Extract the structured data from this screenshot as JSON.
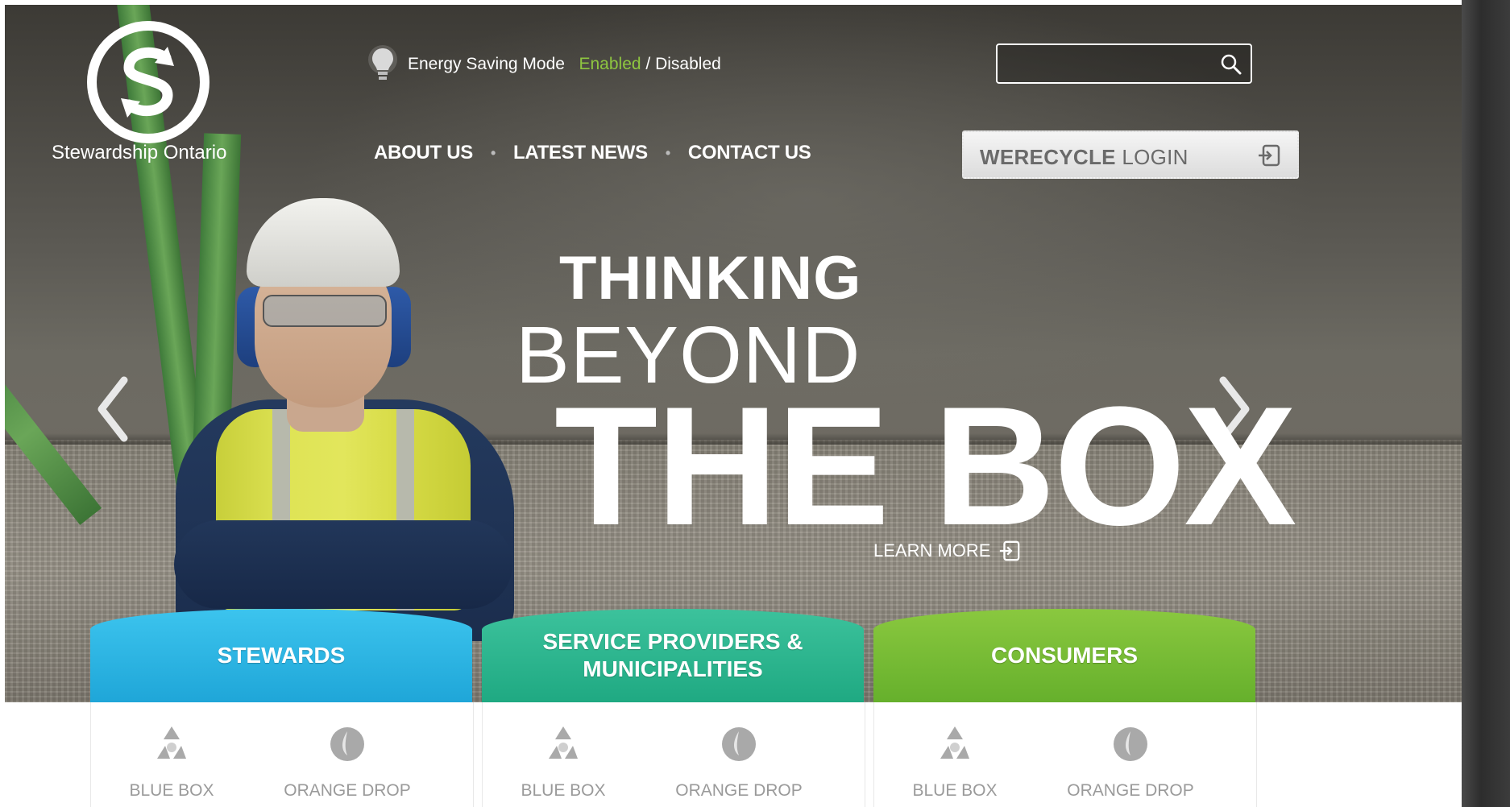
{
  "brand": {
    "name": "Stewardship Ontario"
  },
  "energy": {
    "label": "Energy Saving Mode",
    "enabled": "Enabled",
    "separator": "/",
    "disabled": "Disabled"
  },
  "search": {
    "value": "",
    "placeholder": ""
  },
  "nav": {
    "items": [
      "ABOUT US",
      "LATEST NEWS",
      "CONTACT US"
    ],
    "separator": "•"
  },
  "login": {
    "bold": "WERECYCLE",
    "rest": " LOGIN"
  },
  "hero": {
    "line1": "THINKING",
    "line2": "BEYOND",
    "line3": "THE BOX",
    "learn_more": "LEARN MORE"
  },
  "categories": [
    {
      "title": "STEWARDS",
      "color": "#1fa6d8",
      "programs": [
        "BLUE BOX",
        "ORANGE DROP"
      ]
    },
    {
      "title": "SERVICE PROVIDERS &\nMUNICIPALITIES",
      "color": "#1fa982",
      "programs": [
        "BLUE BOX",
        "ORANGE DROP"
      ]
    },
    {
      "title": "CONSUMERS",
      "color": "#66b02c",
      "programs": [
        "BLUE BOX",
        "ORANGE DROP"
      ]
    }
  ],
  "icons": [
    "bulb-icon",
    "search-icon",
    "login-icon",
    "learn-more-icon",
    "chevron-left-icon",
    "chevron-right-icon",
    "recycle-icon",
    "orange-drop-icon"
  ],
  "colors": {
    "energy_enabled": "#8ec640",
    "login_text": "#6a6a6a",
    "program_label": "#9a9a9a"
  }
}
